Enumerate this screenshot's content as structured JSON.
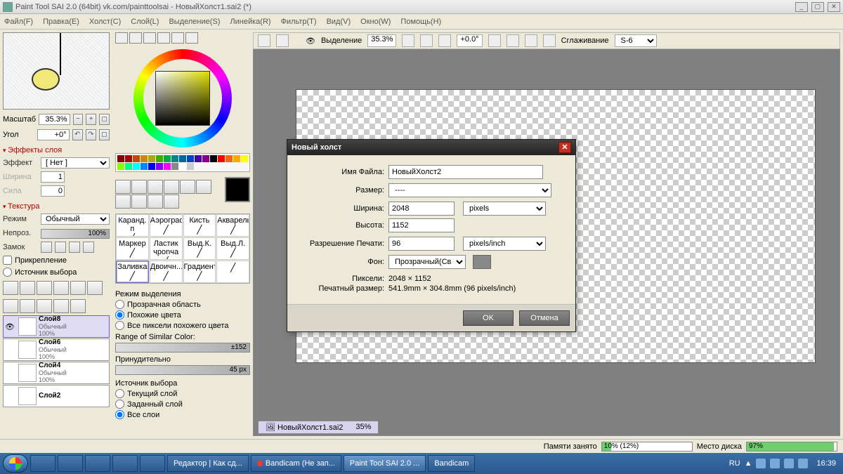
{
  "title": "Paint Tool SAI 2.0 (64bit) vk.com/painttoolsai - НовыйХолст1.sai2 (*)",
  "menu": [
    "Файл(F)",
    "Правка(E)",
    "Холст(C)",
    "Слой(L)",
    "Выделение(S)",
    "Линейка(R)",
    "Фильтр(T)",
    "Вид(V)",
    "Окно(W)",
    "Помощь(H)"
  ],
  "nav": {
    "scale_label": "Масштаб",
    "scale_value": "35.3%",
    "angle_label": "Угол",
    "angle_value": "+0°"
  },
  "layer_effects": {
    "header": "Эффекты слоя",
    "effect_label": "Эффект",
    "effect_value": "[ Нет ]",
    "width_label": "Ширина",
    "width_value": "1",
    "strength_label": "Сила",
    "strength_value": "0"
  },
  "texture": {
    "header": "Текстура",
    "mode_label": "Режим",
    "mode_value": "Обычный",
    "opacity_label": "Непроз.",
    "opacity_value": "100%",
    "lock_label": "Замок",
    "pin_label": "Прикрепление",
    "src_label": "Источник выбора"
  },
  "layers": [
    {
      "name": "Слой8",
      "mode": "Обычный",
      "pct": "100%",
      "sel": true,
      "eye": true
    },
    {
      "name": "Слой6",
      "mode": "Обычный",
      "pct": "100%",
      "sel": false,
      "eye": false
    },
    {
      "name": "Слой4",
      "mode": "Обычный",
      "pct": "100%",
      "sel": false,
      "eye": false
    },
    {
      "name": "Слой2",
      "mode": "",
      "pct": "",
      "sel": false,
      "eye": false
    }
  ],
  "brushes": [
    {
      "n": "Каранд. п"
    },
    {
      "n": "Аэрограф"
    },
    {
      "n": "Кисть"
    },
    {
      "n": "Акварель"
    },
    {
      "n": "Маркер"
    },
    {
      "n": "Ластик чponча"
    },
    {
      "n": "Выд.К."
    },
    {
      "n": "Выд.Л."
    },
    {
      "n": "Заливка",
      "sel": true
    },
    {
      "n": "Двоичн..."
    },
    {
      "n": "Градиент"
    },
    {
      "n": ""
    }
  ],
  "selmode": {
    "header": "Режим выделения",
    "o1": "Прозрачная область",
    "o2": "Похожие цвета",
    "o3": "Все пиксели похожего цвета",
    "range_label": "Range of Similar Color:",
    "range_value": "±152",
    "force_label": "Принудительно",
    "force_value": "45 px",
    "src_header": "Источник выбора",
    "s1": "Текущий слой",
    "s2": "Заданный слой",
    "s3": "Все слои"
  },
  "canvas_tb": {
    "sel_label": "Выделение",
    "zoom": "35.3%",
    "angle": "+0.0°",
    "smooth_label": "Сглаживание",
    "smooth_value": "S-6"
  },
  "doc_tab": {
    "name": "НовыйХолст1.sai2",
    "zoom": "35%"
  },
  "dialog": {
    "title": "Новый холст",
    "filename_label": "Имя Файла:",
    "filename": "НовыйХолст2",
    "size_label": "Размер:",
    "size": "----",
    "width_label": "Ширина:",
    "width": "2048",
    "height_label": "Высота:",
    "height": "1152",
    "unit": "pixels",
    "res_label": "Разрешение Печати:",
    "res": "96",
    "res_unit": "pixels/inch",
    "bg_label": "Фон:",
    "bg": "Прозрачный(Свет",
    "pixels_label": "Пиксели:",
    "pixels": "2048 × 1152",
    "print_label": "Печатный размер:",
    "print": "541.9mm × 304.8mm (96 pixels/inch)",
    "ok": "OK",
    "cancel": "Отмена"
  },
  "status": {
    "mem_label": "Памяти занято",
    "mem_text": "10% (12%)",
    "mem_fill": 10,
    "disk_label": "Место диска",
    "disk_text": "97%",
    "disk_fill": 97
  },
  "taskbar": {
    "items": [
      {
        "label": "Редактор | Как сд..."
      },
      {
        "label": "Bandicam (Не зап...",
        "rec": true
      },
      {
        "label": "Paint Tool SAI 2.0 ...",
        "active": true
      },
      {
        "label": "Bandicam"
      }
    ],
    "lang": "RU",
    "time": "16:39"
  },
  "swatch_colors": [
    "#800",
    "#a00",
    "#c40",
    "#c80",
    "#aa0",
    "#4a0",
    "#0a4",
    "#088",
    "#06a",
    "#04c",
    "#40a",
    "#808",
    "#000",
    "#f00",
    "#f60",
    "#fa0",
    "#ff0",
    "#8f0",
    "#0f8",
    "#0ff",
    "#08f",
    "#00f",
    "#80f",
    "#f0f",
    "#888",
    "#fff",
    "#ccc"
  ]
}
